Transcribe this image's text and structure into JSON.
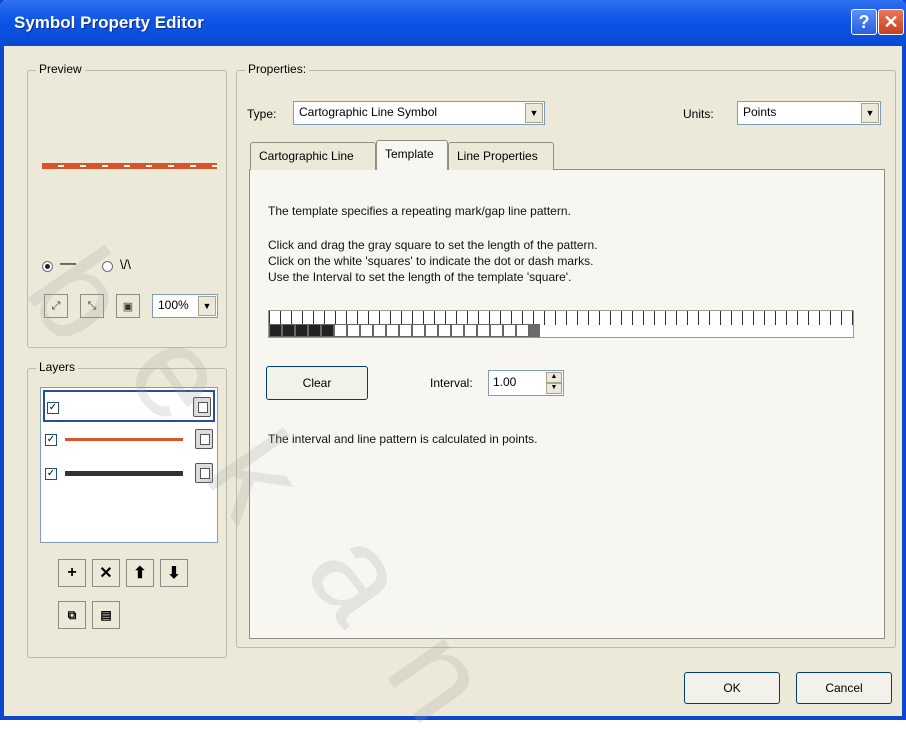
{
  "window": {
    "title": "Symbol Property Editor",
    "help_glyph": "?",
    "close_glyph": "✕"
  },
  "preview": {
    "label": "Preview",
    "radio_line_glyph": "—",
    "radio_wave_glyph": "\\/\\",
    "zoom_value": "100%",
    "tools": [
      "zoom-in-icon",
      "zoom-out-icon",
      "actual-size-icon"
    ]
  },
  "layers": {
    "label": "Layers",
    "items": [
      {
        "checked": true,
        "selected": true,
        "color": "#ffffff"
      },
      {
        "checked": true,
        "selected": false,
        "color": "#d9542b"
      },
      {
        "checked": true,
        "selected": false,
        "color": "#333333"
      }
    ],
    "check_glyph": "✓",
    "add_glyph": "+",
    "remove_glyph": "✕",
    "up_glyph": "⬆",
    "down_glyph": "⬇"
  },
  "properties": {
    "label": "Properties:",
    "type_label": "Type:",
    "type_value": "Cartographic Line Symbol",
    "units_label": "Units:",
    "units_value": "Points",
    "tabs": [
      "Cartographic Line",
      "Template",
      "Line Properties"
    ],
    "active_tab": 1
  },
  "template": {
    "line1": "The template specifies a repeating mark/gap line pattern.",
    "line2": "Click and drag the gray square to set the length of the pattern.",
    "line3": "Click on the white 'squares' to indicate the dot or dash marks.",
    "line4": "Use the Interval to set the length of the template 'square'.",
    "clear_label": "Clear",
    "interval_label": "Interval:",
    "interval_value": "1.00",
    "footer": "The interval and line pattern is calculated in points.",
    "pattern": [
      1,
      1,
      1,
      1,
      1,
      0,
      0,
      0,
      0,
      0,
      0,
      0,
      0,
      0,
      0,
      0,
      0,
      0,
      0,
      0
    ]
  },
  "footer": {
    "ok_label": "OK",
    "cancel_label": "Cancel"
  },
  "colors": {
    "title_blue": "#0d55e6",
    "accent_red": "#d9542b"
  }
}
